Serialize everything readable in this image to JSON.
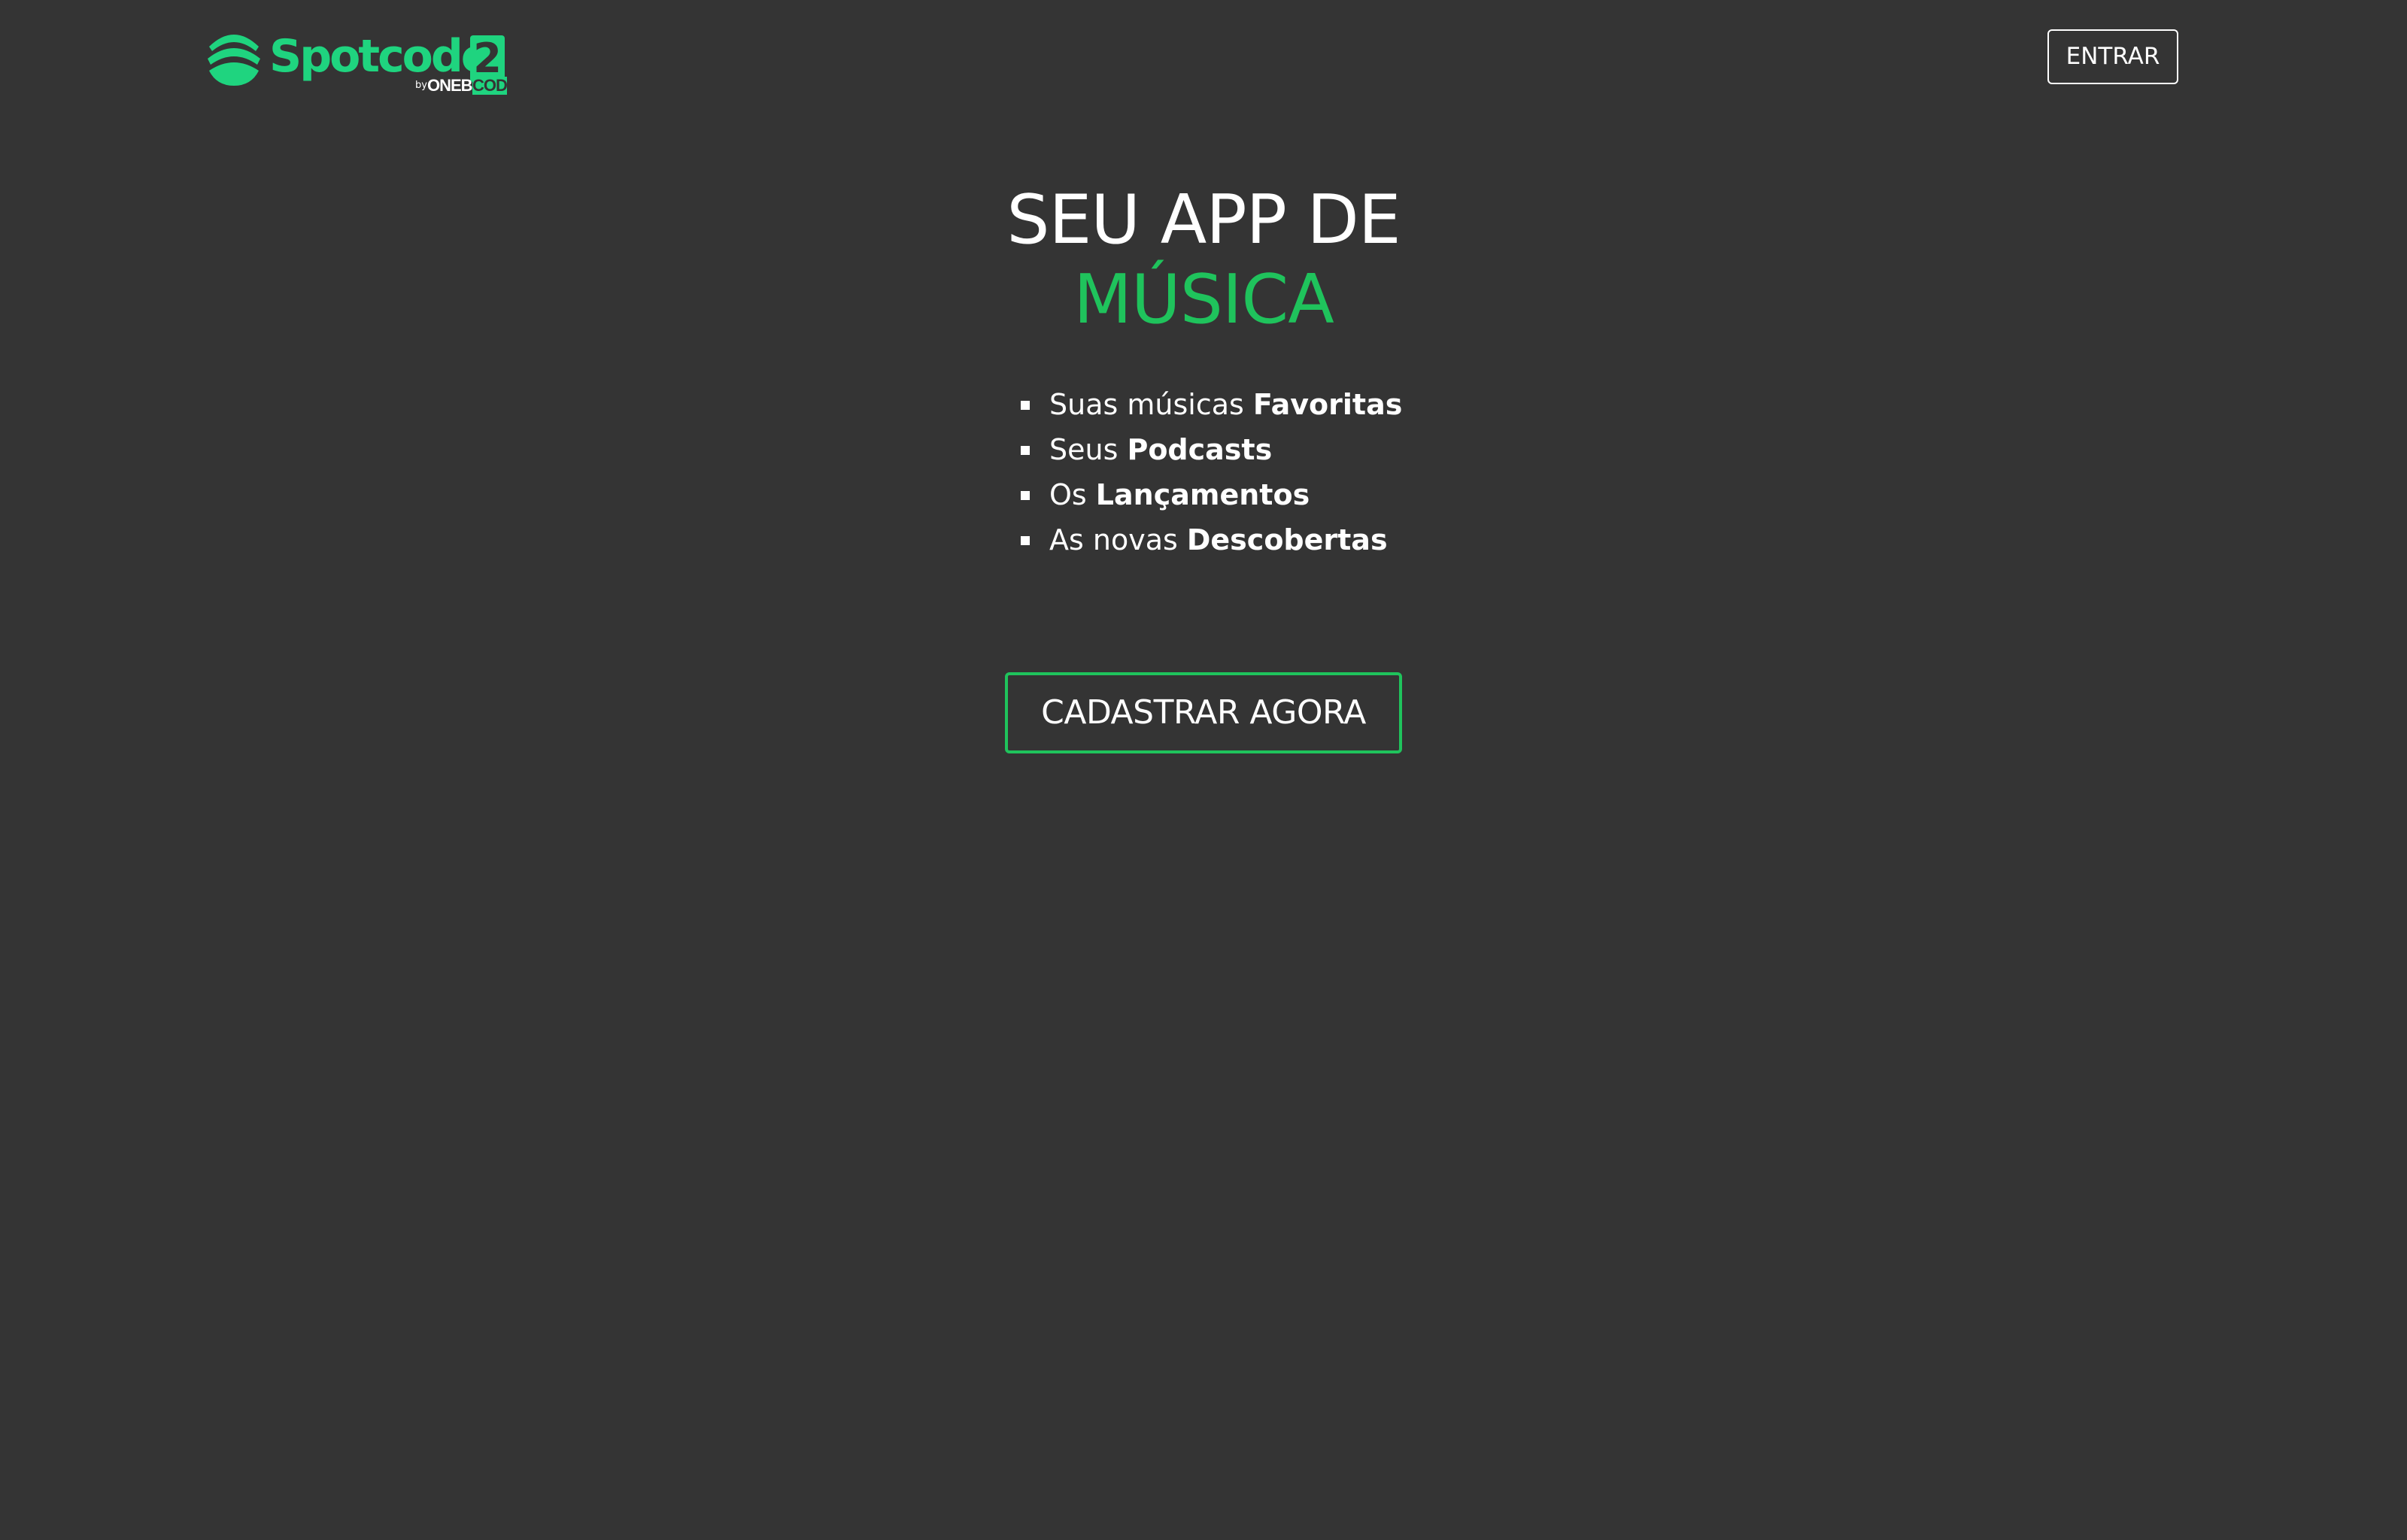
{
  "header": {
    "logo": {
      "wordmark": "Spotcode",
      "badge": "2",
      "by": "by",
      "sub_brand_primary": "ONEBIT",
      "sub_brand_accent": "CODE"
    },
    "login_label": "ENTRAR"
  },
  "hero": {
    "title_line1": "SEU APP DE",
    "title_line2": "MÚSICA",
    "features": [
      {
        "prefix": "Suas músicas",
        "highlight": "Favoritas"
      },
      {
        "prefix": "Seus",
        "highlight": "Podcasts"
      },
      {
        "prefix": "Os",
        "highlight": "Lançamentos"
      },
      {
        "prefix": "As novas",
        "highlight": "Descobertas"
      }
    ],
    "cta_label": "CADASTRAR AGORA"
  },
  "colors": {
    "background": "#343434",
    "brand_green": "#1fd47f",
    "accent_green": "#1fc35c",
    "text": "#ffffff"
  },
  "icons": {
    "logo_mark": "spotcode-logo-icon",
    "bullet": "square-bullet-icon"
  }
}
